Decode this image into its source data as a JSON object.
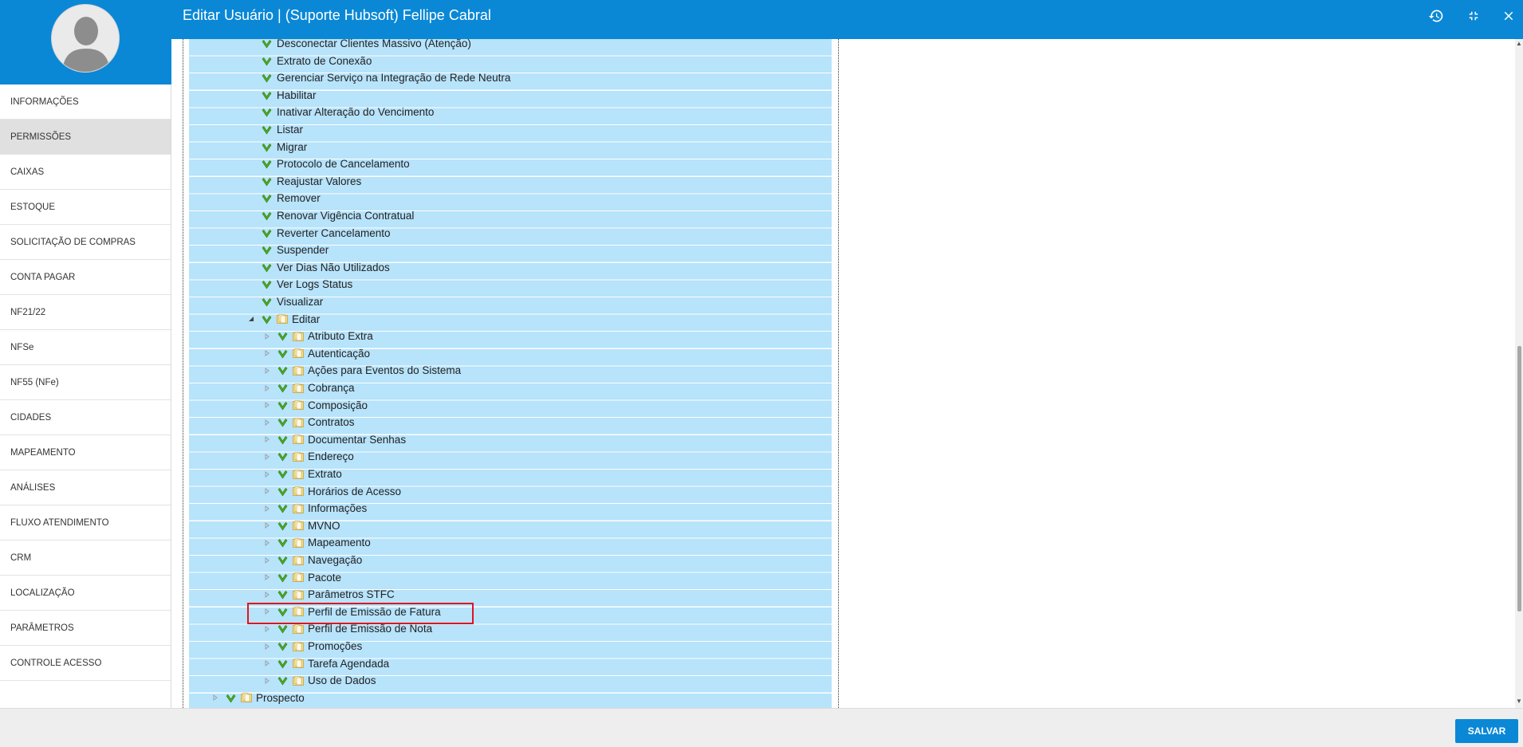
{
  "header": {
    "title": "Editar Usuário | (Suporte Hubsoft) Fellipe Cabral",
    "icons": [
      "history-icon",
      "collapse-icon",
      "close-icon"
    ]
  },
  "sidebar": {
    "items": [
      {
        "label": "INFORMAÇÕES"
      },
      {
        "label": "PERMISSÕES",
        "active": true
      },
      {
        "label": "CAIXAS"
      },
      {
        "label": "ESTOQUE"
      },
      {
        "label": "SOLICITAÇÃO DE COMPRAS"
      },
      {
        "label": "CONTA PAGAR"
      },
      {
        "label": "NF21/22"
      },
      {
        "label": "NFSe"
      },
      {
        "label": "NF55 (NFe)"
      },
      {
        "label": "CIDADES"
      },
      {
        "label": "MAPEAMENTO"
      },
      {
        "label": "ANÁLISES"
      },
      {
        "label": "FLUXO ATENDIMENTO"
      },
      {
        "label": "CRM"
      },
      {
        "label": "LOCALIZAÇÃO"
      },
      {
        "label": "PARÂMETROS"
      },
      {
        "label": "CONTROLE ACESSO"
      }
    ]
  },
  "tree": {
    "level3_items": [
      {
        "label": "Desconectar Clientes Massivo (Atenção)",
        "checked": true
      },
      {
        "label": "Extrato de Conexão",
        "checked": true
      },
      {
        "label": "Gerenciar Serviço na Integração de Rede Neutra",
        "checked": true
      },
      {
        "label": "Habilitar",
        "checked": true
      },
      {
        "label": "Inativar Alteração do Vencimento",
        "checked": true
      },
      {
        "label": "Listar",
        "checked": true
      },
      {
        "label": "Migrar",
        "checked": true
      },
      {
        "label": "Protocolo de Cancelamento",
        "checked": true
      },
      {
        "label": "Reajustar Valores",
        "checked": true
      },
      {
        "label": "Remover",
        "checked": true
      },
      {
        "label": "Renovar Vigência Contratual",
        "checked": true
      },
      {
        "label": "Reverter Cancelamento",
        "checked": true
      },
      {
        "label": "Suspender",
        "checked": true
      },
      {
        "label": "Ver Dias Não Utilizados",
        "checked": true
      },
      {
        "label": "Ver Logs Status",
        "checked": true
      },
      {
        "label": "Visualizar",
        "checked": true
      }
    ],
    "editar_node": {
      "label": "Editar",
      "checked": true,
      "expanded": true
    },
    "editar_children": [
      {
        "label": "Atributo Extra",
        "checked": true
      },
      {
        "label": "Autenticação",
        "checked": true
      },
      {
        "label": "Ações para Eventos do Sistema",
        "checked": true
      },
      {
        "label": "Cobrança",
        "checked": true
      },
      {
        "label": "Composição",
        "checked": true
      },
      {
        "label": "Contratos",
        "checked": true
      },
      {
        "label": "Documentar Senhas",
        "checked": true
      },
      {
        "label": "Endereço",
        "checked": true
      },
      {
        "label": "Extrato",
        "checked": true
      },
      {
        "label": "Horários de Acesso",
        "checked": true
      },
      {
        "label": "Informações",
        "checked": true
      },
      {
        "label": "MVNO",
        "checked": true
      },
      {
        "label": "Mapeamento",
        "checked": true
      },
      {
        "label": "Navegação",
        "checked": true
      },
      {
        "label": "Pacote",
        "checked": true
      },
      {
        "label": "Parâmetros STFC",
        "checked": true
      },
      {
        "label": "Perfil de Emissão de Fatura",
        "checked": true,
        "highlighted": true
      },
      {
        "label": "Perfil de Emissão de Nota",
        "checked": true
      },
      {
        "label": "Promoções",
        "checked": true
      },
      {
        "label": "Tarefa Agendada",
        "checked": true
      },
      {
        "label": "Uso de Dados",
        "checked": true
      }
    ],
    "root_sibling": {
      "label": "Prospecto",
      "checked": true,
      "expanded": false
    }
  },
  "footer": {
    "save_label": "SALVAR"
  },
  "colors": {
    "brand": "#0a88d6",
    "tree_row": "#b7e3fb",
    "check": "#4aaa1e",
    "highlight": "#e0141e"
  }
}
